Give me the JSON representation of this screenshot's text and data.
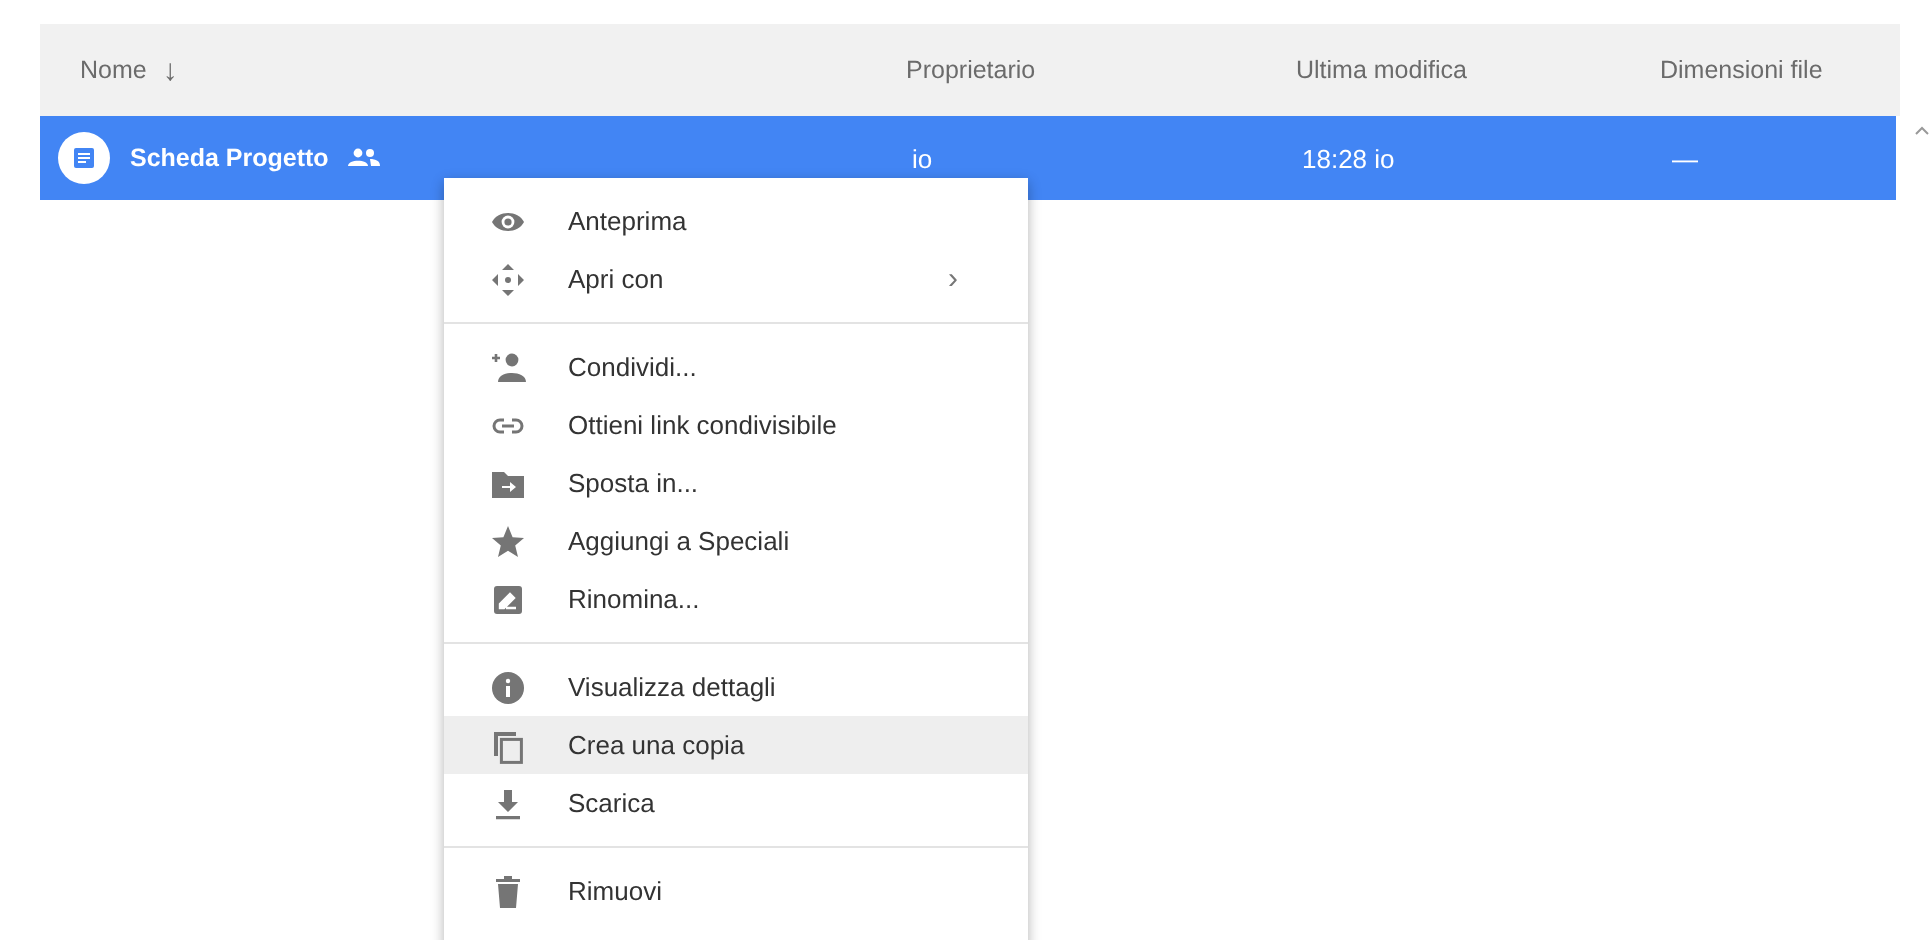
{
  "table": {
    "columns": [
      {
        "label": "Nome",
        "sort_arrow": "↓"
      },
      {
        "label": "Proprietario"
      },
      {
        "label": "Ultima modifica"
      },
      {
        "label": "Dimensioni file"
      }
    ],
    "rows": [
      {
        "name": "Scheda Progetto",
        "shared": true,
        "owner": "io",
        "modified": "18:28 io",
        "size": "—",
        "selected": true
      }
    ]
  },
  "context_menu": {
    "groups": [
      [
        {
          "label": "Anteprima",
          "selected": false
        },
        {
          "label": "Apri con",
          "submenu": "›",
          "selected": false
        }
      ],
      [
        {
          "label": "Condividi...",
          "selected": false
        },
        {
          "label": "Ottieni link condivisibile",
          "selected": false
        },
        {
          "label": "Sposta in...",
          "selected": false
        },
        {
          "label": "Aggiungi a Speciali",
          "selected": false
        },
        {
          "label": "Rinomina...",
          "selected": false
        }
      ],
      [
        {
          "label": "Visualizza dettagli",
          "selected": false
        },
        {
          "label": "Crea una copia",
          "selected": true
        },
        {
          "label": "Scarica",
          "selected": false
        }
      ],
      [
        {
          "label": "Rimuovi",
          "selected": false
        }
      ]
    ]
  }
}
